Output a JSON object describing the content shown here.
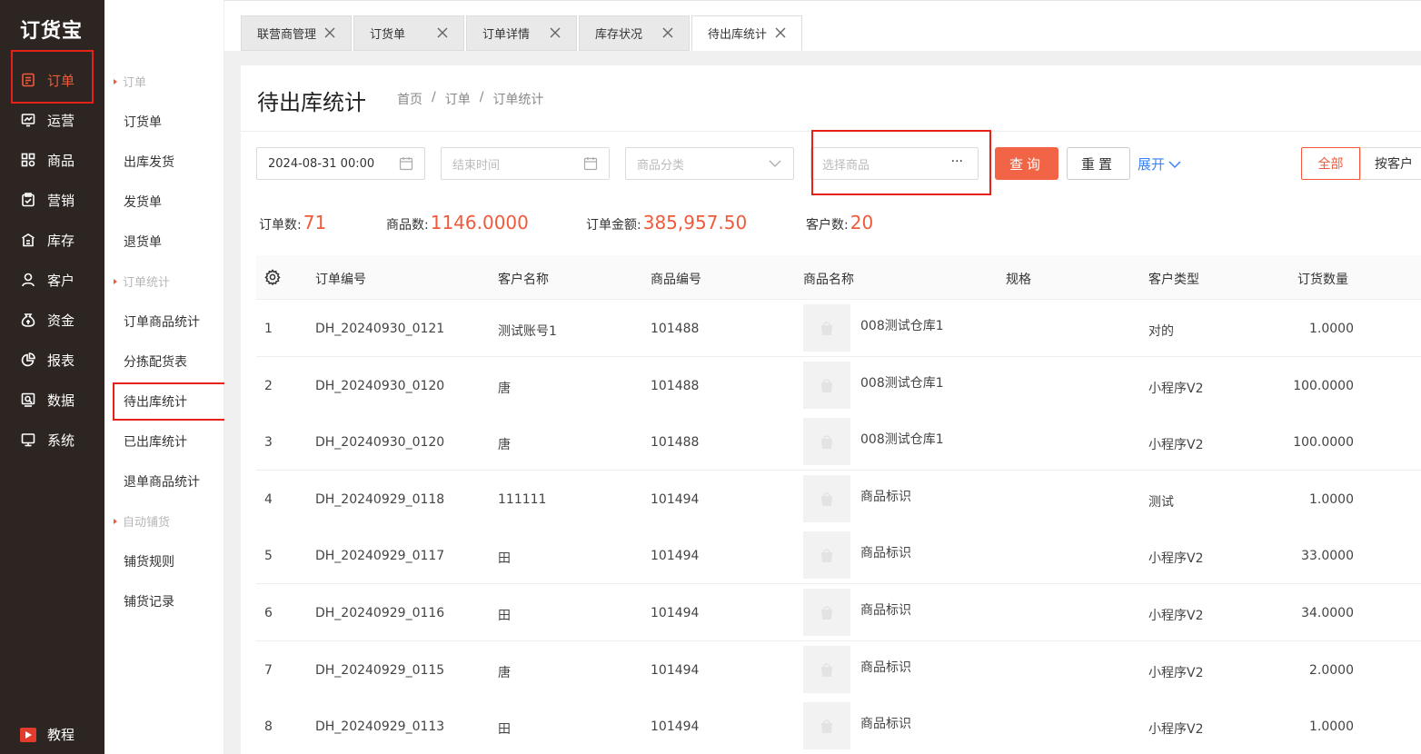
{
  "app": {
    "logo": "订货宝"
  },
  "nav": {
    "items": [
      {
        "label": "订单",
        "icon": "order-icon"
      },
      {
        "label": "运营",
        "icon": "operation-icon"
      },
      {
        "label": "商品",
        "icon": "goods-icon"
      },
      {
        "label": "营销",
        "icon": "marketing-icon"
      },
      {
        "label": "库存",
        "icon": "warehouse-icon"
      },
      {
        "label": "客户",
        "icon": "customer-icon"
      },
      {
        "label": "资金",
        "icon": "money-icon"
      },
      {
        "label": "报表",
        "icon": "chart-pie-icon"
      },
      {
        "label": "数据",
        "icon": "data-icon"
      },
      {
        "label": "系统",
        "icon": "monitor-icon"
      }
    ],
    "tutorial": "教程"
  },
  "submenu": {
    "group1": "订单",
    "item1": "订货单",
    "item2": "出库发货",
    "item3": "发货单",
    "item4": "退货单",
    "group2": "订单统计",
    "item5": "订单商品统计",
    "item6": "分拣配货表",
    "item7": "待出库统计",
    "item8": "已出库统计",
    "item9": "退单商品统计",
    "group3": "自动铺货",
    "item10": "铺货规则",
    "item11": "铺货记录"
  },
  "tabs": [
    "联营商管理",
    "订货单",
    "订单详情",
    "库存状况",
    "待出库统计"
  ],
  "page": {
    "title": "待出库统计",
    "breadcrumb": [
      "首页",
      "/",
      "订单",
      "/",
      "订单统计"
    ]
  },
  "filters": {
    "start_date": "2024-08-31 00:00",
    "end_placeholder": "结束时间",
    "category_placeholder": "商品分类",
    "product_placeholder": "选择商品",
    "more": "···",
    "query": "查询",
    "reset": "重置",
    "expand": "展开",
    "seg_all": "全部",
    "seg_customer": "按客户"
  },
  "stats": {
    "orders_label": "订单数:",
    "orders_value": "71",
    "goods_label": "商品数:",
    "goods_value": "1146.0000",
    "amount_label": "订单金额:",
    "amount_value": "385,957.50",
    "customers_label": "客户数:",
    "customers_value": "20"
  },
  "table": {
    "headers": [
      "订单编号",
      "客户名称",
      "商品编号",
      "商品名称",
      "规格",
      "客户类型",
      "订货数量"
    ],
    "rows": [
      {
        "idx": "1",
        "order": "DH_20240930_0121",
        "customer": "测试账号1",
        "code": "101488",
        "name": "008测试仓库1",
        "spec": "",
        "ctype": "对的",
        "qty": "1.0000"
      },
      {
        "idx": "2",
        "order": "DH_20240930_0120",
        "customer": "唐",
        "code": "101488",
        "name": "008测试仓库1",
        "spec": "",
        "ctype": "小程序V2",
        "qty": "100.0000"
      },
      {
        "idx": "3",
        "order": "DH_20240930_0120",
        "customer": "唐",
        "code": "101488",
        "name": "008测试仓库1",
        "spec": "",
        "ctype": "小程序V2",
        "qty": "100.0000"
      },
      {
        "idx": "4",
        "order": "DH_20240929_0118",
        "customer": "111111",
        "code": "101494",
        "name": "商品标识",
        "spec": "",
        "ctype": "测试",
        "qty": "1.0000"
      },
      {
        "idx": "5",
        "order": "DH_20240929_0117",
        "customer": "田",
        "code": "101494",
        "name": "商品标识",
        "spec": "",
        "ctype": "小程序V2",
        "qty": "33.0000"
      },
      {
        "idx": "6",
        "order": "DH_20240929_0116",
        "customer": "田",
        "code": "101494",
        "name": "商品标识",
        "spec": "",
        "ctype": "小程序V2",
        "qty": "34.0000"
      },
      {
        "idx": "7",
        "order": "DH_20240929_0115",
        "customer": "唐",
        "code": "101494",
        "name": "商品标识",
        "spec": "",
        "ctype": "小程序V2",
        "qty": "2.0000"
      },
      {
        "idx": "8",
        "order": "DH_20240929_0113",
        "customer": "田",
        "code": "101494",
        "name": "商品标识",
        "spec": "",
        "ctype": "小程序V2",
        "qty": "1.0000"
      }
    ]
  },
  "colors": {
    "accent": "#f05a3a",
    "sidebar": "#2d2522",
    "link": "#3b82f6",
    "highlight": "#e5221a"
  }
}
